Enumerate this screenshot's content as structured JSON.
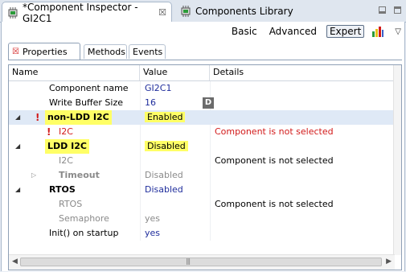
{
  "view_tabs": [
    {
      "label": "*Component Inspector - GI2C1",
      "close": "☒"
    },
    {
      "label": "Components Library"
    }
  ],
  "modes": [
    "Basic",
    "Advanced",
    "Expert"
  ],
  "subtabs": [
    "Properties",
    "Methods",
    "Events"
  ],
  "columns": [
    "Name",
    "Value",
    "Details"
  ],
  "rows": [
    {
      "name": "Component name",
      "value": "GI2C1",
      "details": ""
    },
    {
      "name": "Write Buffer Size",
      "value": "16",
      "details": "",
      "button": "D"
    },
    {
      "name": "non-LDD I2C",
      "value": "Enabled",
      "details": ""
    },
    {
      "name": "I2C",
      "value": "",
      "details": "Component is not selected"
    },
    {
      "name": "LDD I2C",
      "value": "Disabled",
      "details": ""
    },
    {
      "name": "I2C",
      "value": "",
      "details": "Component is not selected"
    },
    {
      "name": "Timeout",
      "value": "Disabled",
      "details": ""
    },
    {
      "name": "RTOS",
      "value": "Disabled",
      "details": ""
    },
    {
      "name": "RTOS",
      "value": "",
      "details": "Component is not selected"
    },
    {
      "name": "Semaphore",
      "value": "yes",
      "details": ""
    },
    {
      "name": "Init() on startup",
      "value": "yes",
      "details": ""
    }
  ],
  "colors": {
    "accent_blue": "#1f2d9c",
    "error_red": "#d21a1a",
    "highlight_yellow": "#ffff66",
    "selected_row": "#dfe9f6"
  }
}
